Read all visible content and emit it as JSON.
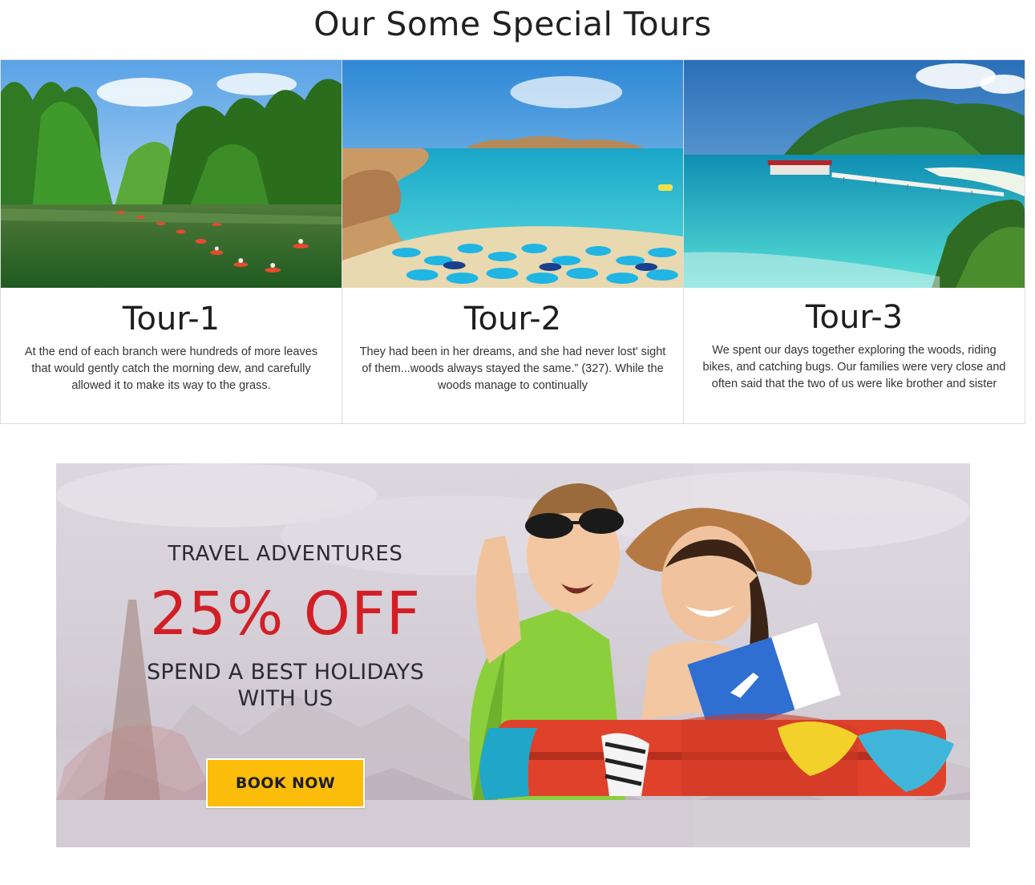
{
  "section": {
    "title": "Our Some Special Tours"
  },
  "tours": [
    {
      "title": "Tour-1",
      "description": "At the end of each branch were hundreds of more leaves that would gently catch the morning dew, and carefully allowed it to make its way to the grass."
    },
    {
      "title": "Tour-2",
      "description": "They had been in her dreams, and she had never lost' sight of them...woods always stayed the same.” (327). While the woods manage to continually"
    },
    {
      "title": "Tour-3",
      "description": "We spent our days together exploring the woods, riding bikes, and catching bugs. Our families were very close and often said that the two of us were like brother and sister"
    }
  ],
  "banner": {
    "kicker": "TRAVEL ADVENTURES",
    "offer": "25% OFF",
    "subtitle": "SPEND A BEST HOLIDAYS WITH US",
    "button_label": "BOOK NOW"
  },
  "colors": {
    "offer_red": "#d21f26",
    "button_yellow": "#fcbd0a"
  }
}
